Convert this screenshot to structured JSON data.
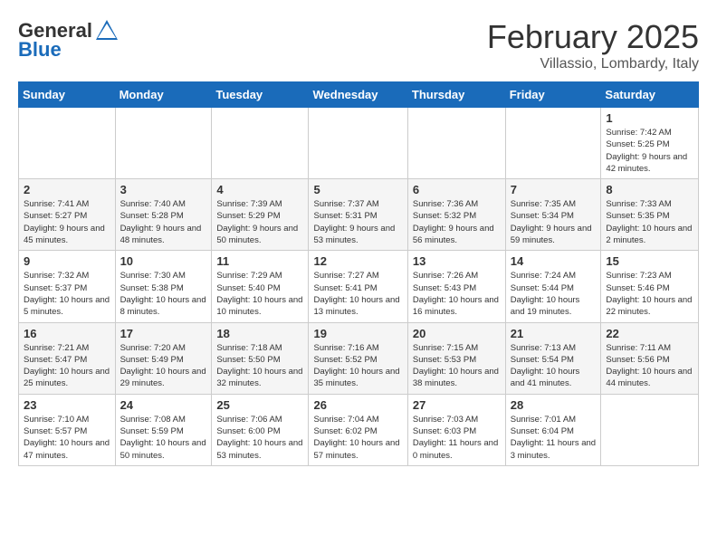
{
  "logo": {
    "general": "General",
    "blue": "Blue"
  },
  "header": {
    "month": "February 2025",
    "location": "Villassio, Lombardy, Italy"
  },
  "days_of_week": [
    "Sunday",
    "Monday",
    "Tuesday",
    "Wednesday",
    "Thursday",
    "Friday",
    "Saturday"
  ],
  "weeks": [
    [
      {
        "num": "",
        "info": ""
      },
      {
        "num": "",
        "info": ""
      },
      {
        "num": "",
        "info": ""
      },
      {
        "num": "",
        "info": ""
      },
      {
        "num": "",
        "info": ""
      },
      {
        "num": "",
        "info": ""
      },
      {
        "num": "1",
        "info": "Sunrise: 7:42 AM\nSunset: 5:25 PM\nDaylight: 9 hours and 42 minutes."
      }
    ],
    [
      {
        "num": "2",
        "info": "Sunrise: 7:41 AM\nSunset: 5:27 PM\nDaylight: 9 hours and 45 minutes."
      },
      {
        "num": "3",
        "info": "Sunrise: 7:40 AM\nSunset: 5:28 PM\nDaylight: 9 hours and 48 minutes."
      },
      {
        "num": "4",
        "info": "Sunrise: 7:39 AM\nSunset: 5:29 PM\nDaylight: 9 hours and 50 minutes."
      },
      {
        "num": "5",
        "info": "Sunrise: 7:37 AM\nSunset: 5:31 PM\nDaylight: 9 hours and 53 minutes."
      },
      {
        "num": "6",
        "info": "Sunrise: 7:36 AM\nSunset: 5:32 PM\nDaylight: 9 hours and 56 minutes."
      },
      {
        "num": "7",
        "info": "Sunrise: 7:35 AM\nSunset: 5:34 PM\nDaylight: 9 hours and 59 minutes."
      },
      {
        "num": "8",
        "info": "Sunrise: 7:33 AM\nSunset: 5:35 PM\nDaylight: 10 hours and 2 minutes."
      }
    ],
    [
      {
        "num": "9",
        "info": "Sunrise: 7:32 AM\nSunset: 5:37 PM\nDaylight: 10 hours and 5 minutes."
      },
      {
        "num": "10",
        "info": "Sunrise: 7:30 AM\nSunset: 5:38 PM\nDaylight: 10 hours and 8 minutes."
      },
      {
        "num": "11",
        "info": "Sunrise: 7:29 AM\nSunset: 5:40 PM\nDaylight: 10 hours and 10 minutes."
      },
      {
        "num": "12",
        "info": "Sunrise: 7:27 AM\nSunset: 5:41 PM\nDaylight: 10 hours and 13 minutes."
      },
      {
        "num": "13",
        "info": "Sunrise: 7:26 AM\nSunset: 5:43 PM\nDaylight: 10 hours and 16 minutes."
      },
      {
        "num": "14",
        "info": "Sunrise: 7:24 AM\nSunset: 5:44 PM\nDaylight: 10 hours and 19 minutes."
      },
      {
        "num": "15",
        "info": "Sunrise: 7:23 AM\nSunset: 5:46 PM\nDaylight: 10 hours and 22 minutes."
      }
    ],
    [
      {
        "num": "16",
        "info": "Sunrise: 7:21 AM\nSunset: 5:47 PM\nDaylight: 10 hours and 25 minutes."
      },
      {
        "num": "17",
        "info": "Sunrise: 7:20 AM\nSunset: 5:49 PM\nDaylight: 10 hours and 29 minutes."
      },
      {
        "num": "18",
        "info": "Sunrise: 7:18 AM\nSunset: 5:50 PM\nDaylight: 10 hours and 32 minutes."
      },
      {
        "num": "19",
        "info": "Sunrise: 7:16 AM\nSunset: 5:52 PM\nDaylight: 10 hours and 35 minutes."
      },
      {
        "num": "20",
        "info": "Sunrise: 7:15 AM\nSunset: 5:53 PM\nDaylight: 10 hours and 38 minutes."
      },
      {
        "num": "21",
        "info": "Sunrise: 7:13 AM\nSunset: 5:54 PM\nDaylight: 10 hours and 41 minutes."
      },
      {
        "num": "22",
        "info": "Sunrise: 7:11 AM\nSunset: 5:56 PM\nDaylight: 10 hours and 44 minutes."
      }
    ],
    [
      {
        "num": "23",
        "info": "Sunrise: 7:10 AM\nSunset: 5:57 PM\nDaylight: 10 hours and 47 minutes."
      },
      {
        "num": "24",
        "info": "Sunrise: 7:08 AM\nSunset: 5:59 PM\nDaylight: 10 hours and 50 minutes."
      },
      {
        "num": "25",
        "info": "Sunrise: 7:06 AM\nSunset: 6:00 PM\nDaylight: 10 hours and 53 minutes."
      },
      {
        "num": "26",
        "info": "Sunrise: 7:04 AM\nSunset: 6:02 PM\nDaylight: 10 hours and 57 minutes."
      },
      {
        "num": "27",
        "info": "Sunrise: 7:03 AM\nSunset: 6:03 PM\nDaylight: 11 hours and 0 minutes."
      },
      {
        "num": "28",
        "info": "Sunrise: 7:01 AM\nSunset: 6:04 PM\nDaylight: 11 hours and 3 minutes."
      },
      {
        "num": "",
        "info": ""
      }
    ]
  ]
}
